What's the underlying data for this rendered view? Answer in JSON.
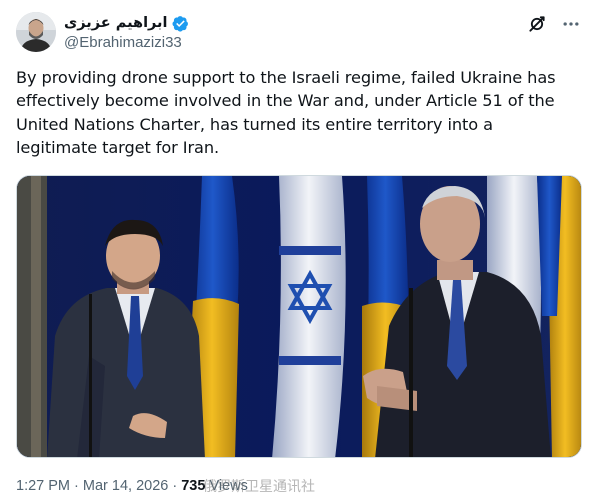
{
  "author": {
    "display_name": "ابراهیم عزیزی",
    "handle": "@Ebrahimazizi33",
    "avatar_icon": "person-avatar-icon",
    "verified_icon": "verified-badge-icon",
    "verified_color": "#1d9bf0"
  },
  "actions": {
    "grok_icon": "grok-icon",
    "more_icon": "more-options-icon"
  },
  "tweet": {
    "text": "By providing drone support to the Israeli regime, failed Ukraine has effectively become involved in the War and, under Article 51 of the United Nations Charter, has turned its entire territory into a legitimate target for Iran."
  },
  "media": {
    "subject": "photo of two men talking in front of Israeli and Ukrainian flags"
  },
  "meta": {
    "time": "1:27 PM",
    "separator": " · ",
    "date": "Mar 14, 2026",
    "views_count": "735",
    "views_label": " Views"
  },
  "watermark": {
    "text": "俄罗斯卫星通讯社"
  }
}
